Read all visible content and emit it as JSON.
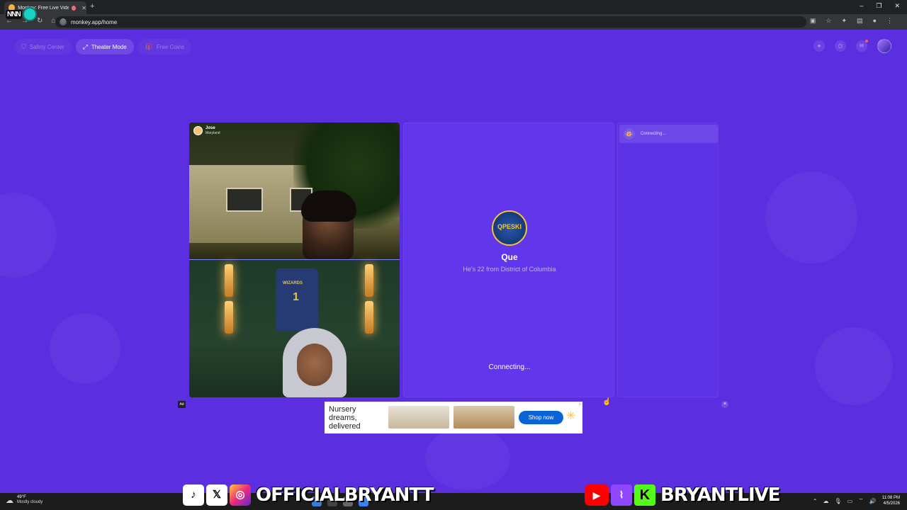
{
  "browser": {
    "tab_title": "Monkey: Free Live Video Ch",
    "url": "monkey.app/home",
    "overlay_logo": "NNN"
  },
  "topnav": {
    "items": [
      {
        "label": "Safety Center",
        "icon": "shield-icon"
      },
      {
        "label": "Theater Mode",
        "icon": "expand-icon"
      },
      {
        "label": "Free Coins",
        "icon": "gift-icon"
      }
    ]
  },
  "video": {
    "user_name": "Jose",
    "user_location": "Maryland",
    "jersey_team": "WIZARDS",
    "jersey_number": "1"
  },
  "match": {
    "avatar_text": "QPESKI",
    "name": "Que",
    "description": "He's 22 from District of Columbia",
    "status": "Connecting..."
  },
  "chat": {
    "header_status": "Connecting..."
  },
  "ad": {
    "badge": "Ad",
    "headline": "Nursery dreams, delivered",
    "cta": "Shop now",
    "close": "×"
  },
  "taskbar": {
    "temperature": "49°F",
    "weather": "Mostly cloudy",
    "time": "11:08 PM",
    "date": "4/5/2026"
  },
  "overlay": {
    "left_handle": "OFFICIALBRYANTT",
    "right_handle": "BRYANTLIVE"
  }
}
